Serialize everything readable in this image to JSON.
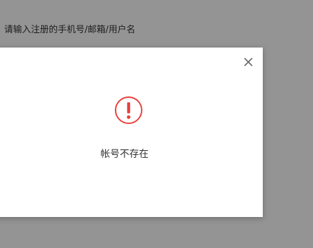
{
  "background": {
    "account_placeholder": "请输入注册的手机号/邮箱/用户名"
  },
  "dialog": {
    "icon": "exclamation-circle-icon",
    "message": "帐号不存在",
    "close_icon": "close-icon"
  },
  "colors": {
    "overlay": "#000000",
    "alert": "#e8403c",
    "message_text": "#333333",
    "close_icon": "#666666"
  }
}
